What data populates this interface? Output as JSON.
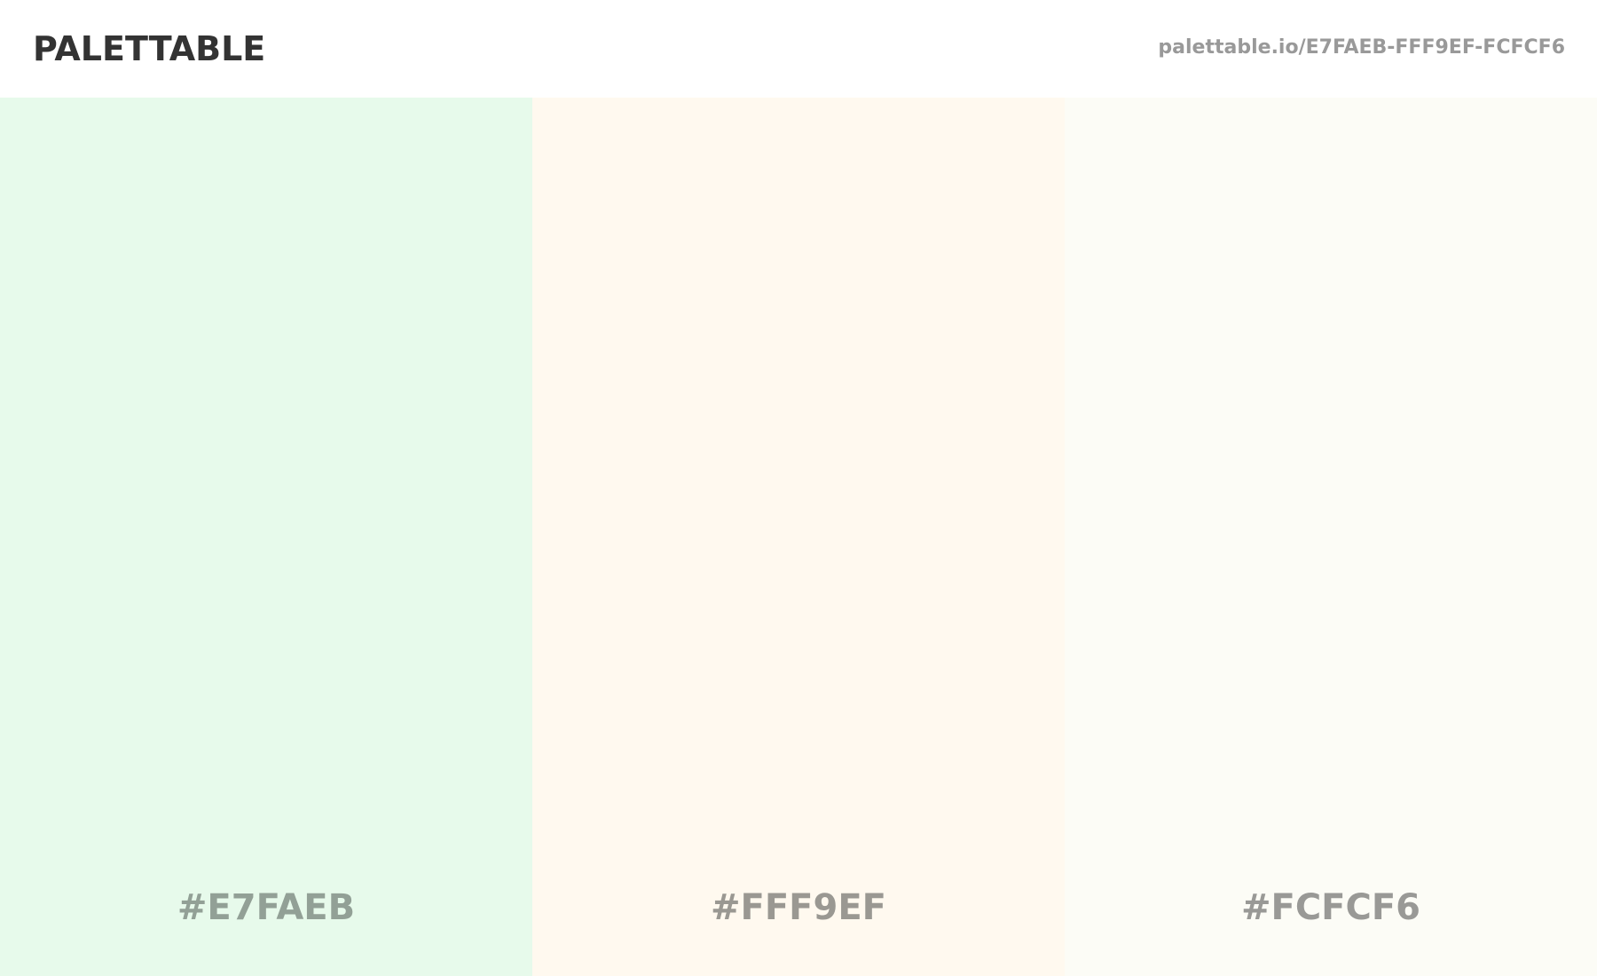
{
  "header": {
    "brand": "PALETTABLE",
    "url": "palettable.io/E7FAEB-FFF9EF-FCFCF6"
  },
  "swatches": [
    {
      "label": "#E7FAEB",
      "color": "#E7FAEB",
      "text_color": "#92A096"
    },
    {
      "label": "#FFF9EF",
      "color": "#FFF9EF",
      "text_color": "#9A9892"
    },
    {
      "label": "#FCFCF6",
      "color": "#FCFCF6",
      "text_color": "#999996"
    }
  ]
}
